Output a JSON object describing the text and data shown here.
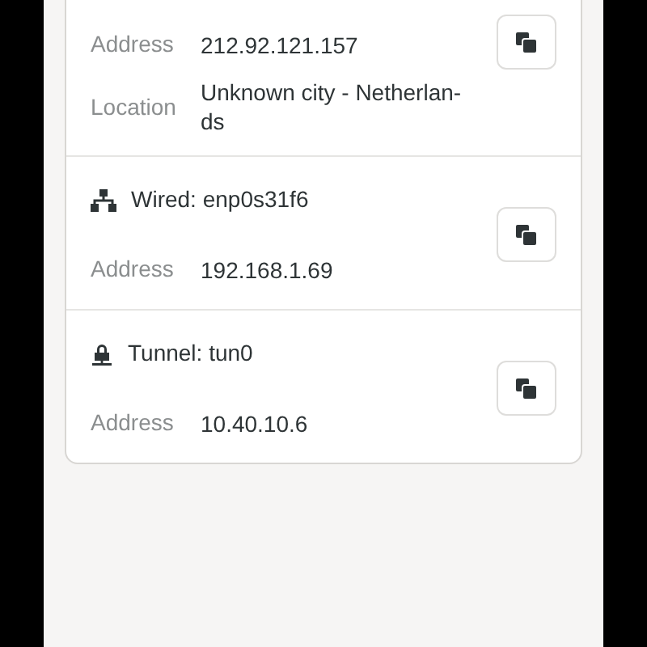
{
  "connections": [
    {
      "rows": [
        {
          "label": "Address",
          "value_lines": [
            "212.92.121.157"
          ]
        },
        {
          "label": "Location",
          "value_lines": [
            "Unknown city - Netherlan-",
            "ds"
          ]
        }
      ]
    },
    {
      "kind": "wired",
      "header": "Wired: enp0s31f6",
      "rows": [
        {
          "label": "Address",
          "value_lines": [
            "192.168.1.69"
          ]
        }
      ]
    },
    {
      "kind": "tunnel",
      "header": "Tunnel: tun0",
      "rows": [
        {
          "label": "Address",
          "value_lines": [
            "10.40.10.6"
          ]
        }
      ]
    }
  ]
}
